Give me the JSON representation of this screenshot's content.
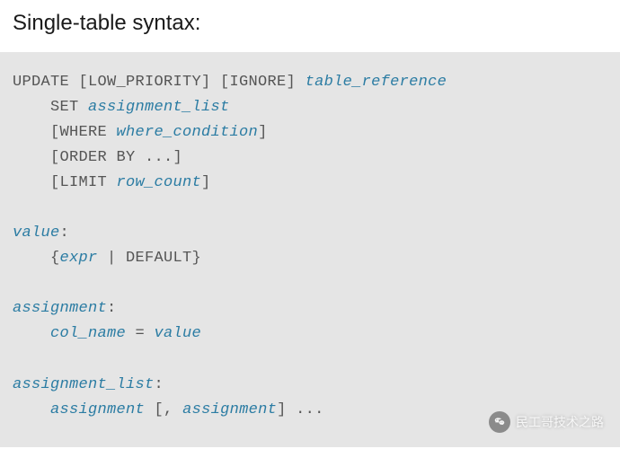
{
  "title": "Single-table syntax:",
  "code": {
    "update": "UPDATE",
    "low_priority": " [LOW_PRIORITY]",
    "ignore": " [IGNORE] ",
    "table_reference": "table_reference",
    "set": "    SET ",
    "assignment_list": "assignment_list",
    "where_open": "    [WHERE ",
    "where_condition": "where_condition",
    "where_close": "]",
    "order_by": "    [ORDER BY ...]",
    "limit_open": "    [LIMIT ",
    "row_count": "row_count",
    "limit_close": "]",
    "value_label": "value",
    "value_colon": ":",
    "value_open": "    {",
    "expr": "expr",
    "value_close": " | DEFAULT}",
    "assignment_label": "assignment",
    "assignment_colon": ":",
    "col_name_indent": "    ",
    "col_name": "col_name",
    "equals": " = ",
    "value_ref": "value",
    "assignment_list_label": "assignment_list",
    "assignment_list_colon": ":",
    "al_indent": "    ",
    "al_assignment": "assignment",
    "al_sep": " [, ",
    "al_assignment2": "assignment",
    "al_end": "] ..."
  },
  "attribution": "民工哥技术之路"
}
